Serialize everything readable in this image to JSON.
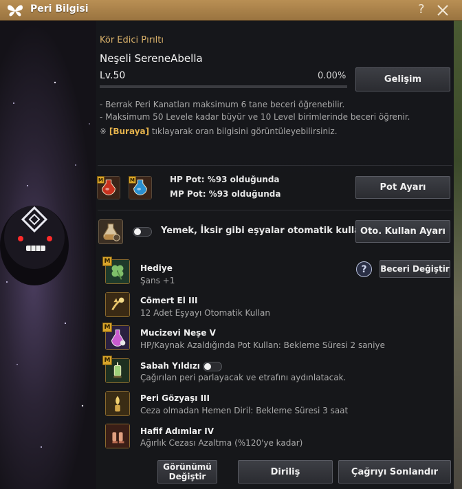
{
  "window": {
    "title": "Peri Bilgisi",
    "help_glyph": "?",
    "icons": [
      "butterfly-logo-icon",
      "close-icon"
    ]
  },
  "pet": {
    "subtitle": "Kör Edici Pırıltı",
    "name": "Neşeli SereneAbella",
    "level": "Lv.50",
    "xp_percent_text": "0.00%",
    "xp_fraction": 0.0
  },
  "buttons": {
    "growth": "Gelişim",
    "pot_settings": "Pot Ayarı",
    "auto_use_settings": "Oto. Kullan Ayarı",
    "change_skill": "Beceri Değiştir",
    "change_look": "Görünümü Değiştir",
    "revive": "Diriliş",
    "end_summon": "Çağrıyı Sonlandır"
  },
  "descriptions": [
    "- Berrak Peri Kanatları maksimum 6 tane beceri öğrenebilir.",
    "- Maksimum 50 Levele kadar büyür ve 10 Level birimlerinde beceri öğrenir."
  ],
  "link_note": {
    "prefix": "※ ",
    "link": "[Buraya]",
    "suffix": " tıklayarak oran bilgisini görüntüleyebilirsiniz."
  },
  "potions": {
    "hp": "HP Pot: %93 olduğunda",
    "mp": "MP Pot: %93 olduğunda",
    "hp_color": "#c8321e",
    "mp_color": "#2a8fd0"
  },
  "auto_use": {
    "text": "Yemek, İksir gibi eşyalar otomatik kullanılır.",
    "toggle_on": false
  },
  "badge_letter": "M",
  "skills": [
    {
      "name": "Hediye",
      "desc": "Şans +1",
      "icon": "clover-icon",
      "mastery": true
    },
    {
      "name": "Cömert El III",
      "desc": "12 Adet Eşyayı Otomatik Kullan",
      "icon": "fairy-hand-icon",
      "mastery": false
    },
    {
      "name": "Mucizevi Neşe V",
      "desc": "HP/Kaynak Azaldığında Pot Kullan: Bekleme Süresi 2 saniye",
      "icon": "potion-flask-icon",
      "mastery": true
    },
    {
      "name": "Sabah Yıldızı",
      "desc": "Çağırılan peri parlayacak ve etrafını aydınlatacak.",
      "icon": "lantern-icon",
      "mastery": true,
      "toggle_on": false
    },
    {
      "name": "Peri Gözyaşı III",
      "desc": "Ceza olmadan Hemen Diril: Bekleme Süresi 3 saat",
      "icon": "tear-vial-icon",
      "mastery": false
    },
    {
      "name": "Hafif Adımlar IV",
      "desc": "Ağırlık Cezası Azaltma (%120'ye kadar)",
      "icon": "feather-boots-icon",
      "mastery": false
    }
  ]
}
